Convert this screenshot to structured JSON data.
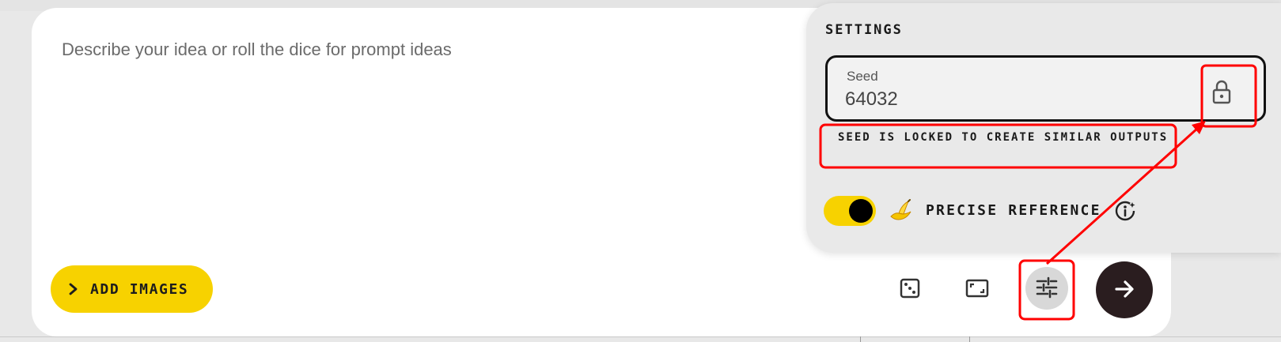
{
  "prompt": {
    "placeholder": "Describe your idea or roll the dice for prompt ideas"
  },
  "toolbar": {
    "add_images_label": "ADD IMAGES",
    "icons": [
      "chevron-right-icon",
      "dice-icon",
      "aspect-ratio-icon",
      "tune-sliders-icon",
      "arrow-right-icon"
    ]
  },
  "settings": {
    "title": "SETTINGS",
    "seed_label": "Seed",
    "seed_value": "64032",
    "seed_note": "SEED IS LOCKED TO CREATE SIMILAR OUTPUTS",
    "precise_reference_label": "PRECISE REFERENCE",
    "precise_reference_enabled": true,
    "icons": [
      "lock-icon",
      "banana-icon",
      "info-icon"
    ]
  },
  "colors": {
    "accent_yellow": "#f7d200",
    "go_button": "#2a1d1f",
    "annotation_red": "#ff0000"
  }
}
